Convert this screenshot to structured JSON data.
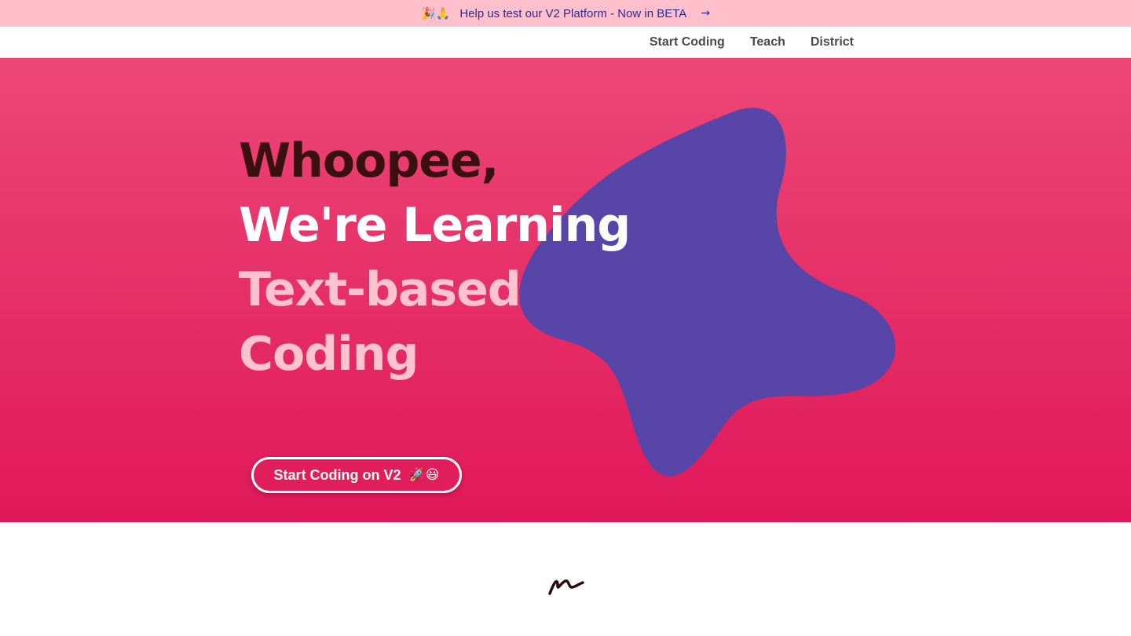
{
  "banner": {
    "emojis": "🎉🙏",
    "text": "Help us test our V2 Platform - Now in BETA",
    "arrow_icon": "→"
  },
  "nav": {
    "items": [
      {
        "label": "Start Coding"
      },
      {
        "label": "Teach"
      },
      {
        "label": "District"
      }
    ]
  },
  "hero": {
    "line1": "Whoopee,",
    "line2": "We're Learning",
    "line3": "Text-based",
    "line4": "Coding",
    "cta_label": "Start Coding on V2",
    "cta_emojis": "🚀😃"
  },
  "colors": {
    "banner_bg": "#ffc0cb",
    "hero_top": "#ec4777",
    "hero_bottom": "#e0185a",
    "blob": "#5746a8",
    "headline_dark": "#3b1010",
    "headline_light": "#ffc2cf"
  },
  "icons": {
    "banner_arrow": "arrow-right-icon",
    "blob": "purple-blob-shape",
    "logo": "scribble-logo-icon"
  }
}
